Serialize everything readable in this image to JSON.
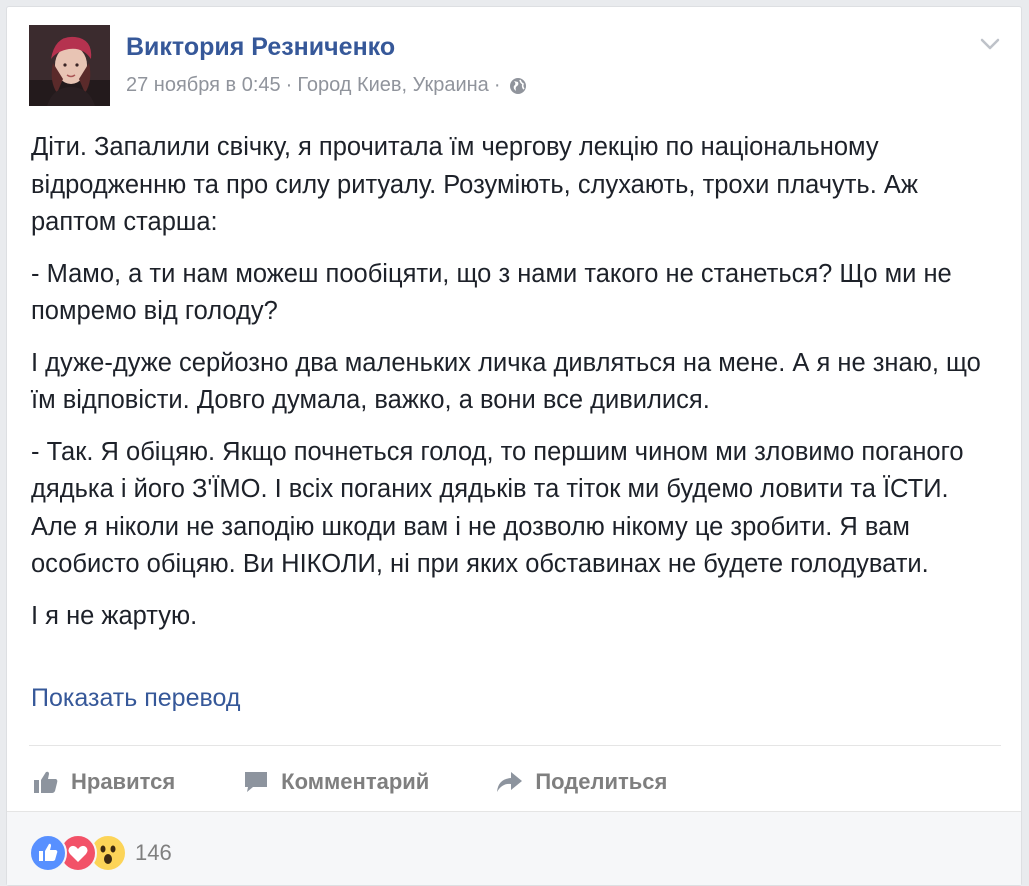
{
  "post": {
    "author": "Виктория Резниченко",
    "date": "27 ноября в 0:45",
    "separator": "·",
    "location": "Город Киев, Украина",
    "privacy_icon": "globe-icon",
    "paragraphs": [
      "Діти. Запалили свічку, я прочитала їм чергову лекцію по національному відродженню та про силу ритуалу. Розуміють, слухають, трохи плачуть. Аж раптом старша:",
      "- Мамо, а ти нам можеш пообіцяти, що з нами такого не станеться? Що ми не помремо від голоду?",
      "І дуже-дуже серйозно два маленьких личка дивляться на мене. А я не знаю, що їм відповісти. Довго думала, важко, а вони все дивилися.",
      "- Так. Я обіцяю. Якщо почнеться голод, то першим чином ми зловимо поганого дядька і його З'ЇМО. І всіх поганих дядьків та тіток ми будемо ловити та ЇСТИ. Але я ніколи не заподію шкоди вам і не дозволю нікому це зробити. Я вам особисто обіцяю. Ви НІКОЛИ, ні при яких обставинах не будете голодувати.",
      "І я не жартую."
    ],
    "translate_link": "Показать перевод"
  },
  "actions": {
    "like": "Нравится",
    "comment": "Комментарий",
    "share": "Поделиться"
  },
  "reactions": {
    "icons": [
      "like-reaction-icon",
      "love-reaction-icon",
      "wow-reaction-icon"
    ],
    "count": "146"
  },
  "colors": {
    "link_blue": "#365899",
    "meta_gray": "#90949c",
    "text": "#1d2129",
    "like_blue": "#5890ff",
    "love_red": "#f25268",
    "wow_yellow": "#fcd458"
  }
}
